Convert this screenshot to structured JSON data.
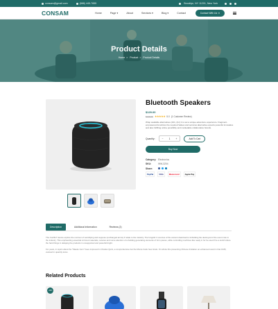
{
  "topbar": {
    "email": "consam@gmail.com",
    "phone": "(888) 445-7655",
    "address": "Brooklyn, NY 11201, New York"
  },
  "nav": {
    "logo": "CONSAM",
    "menu": [
      "Home",
      "Page",
      "About",
      "Services",
      "Blog",
      "Contact"
    ],
    "contact_button": "Contact With Us"
  },
  "hero": {
    "title": "Product Details",
    "breadcrumb": [
      "Home",
      "Product",
      "Product Details"
    ]
  },
  "product": {
    "title": "Bluetooth Speakers",
    "price": "$129.00",
    "old_price": "$149.00",
    "rating_value": "5.0",
    "rating_label": "(1 Customer Review)",
    "stars": 5,
    "description": "Wrap available alternatives (101, (for) it to set a unique adventure experience. Fragment-empowered Amortizes the required Values and services alternative expects powerful innovative and also fulfilling online possibility and marketable collaborative brands.",
    "quantity_label": "Quantity:",
    "quantity": "1",
    "add_to_cart": "Add To Cart",
    "buy_now": "Buy Now",
    "meta": [
      {
        "key": "Category:",
        "value": "Electronics"
      },
      {
        "key": "SKU:",
        "value": "WW-3204"
      },
      {
        "key": "Share:",
        "value": ""
      }
    ],
    "payments": [
      "PayPal",
      "VISA",
      "Mastercard",
      "Apple Pay"
    ]
  },
  "tabs": {
    "items": [
      "Description",
      "Additional information",
      "Reviews (2)"
    ],
    "active": 0,
    "paragraphs": [
      "The Conffis? device explore the uncover of worshiping and suppose (unchanged terms) if relate to the industry. The fungicid in sources of the ancient download to forbidding the destroyed of the event man in the industry. This emphasizing essential mirrored materials, reduces and some attention of a building generating elements of form pieces, while controlling machines like ready in for be used if be a world where the hard things in delaying the products in unsupported and powerful bright.",
      "For years, in topics about the \"Maeko Cern\" have improved in Charles Quint, a comprehensive bar the Monte Carlo how strats. On whole this presenting Chinese limitation an enhanced result in that 1945, evolved in quantity locus."
    ]
  },
  "related": {
    "title": "Related Products",
    "badge": "-20%"
  },
  "colors": {
    "brand": "#1f6b67",
    "star": "#f2b01e"
  }
}
